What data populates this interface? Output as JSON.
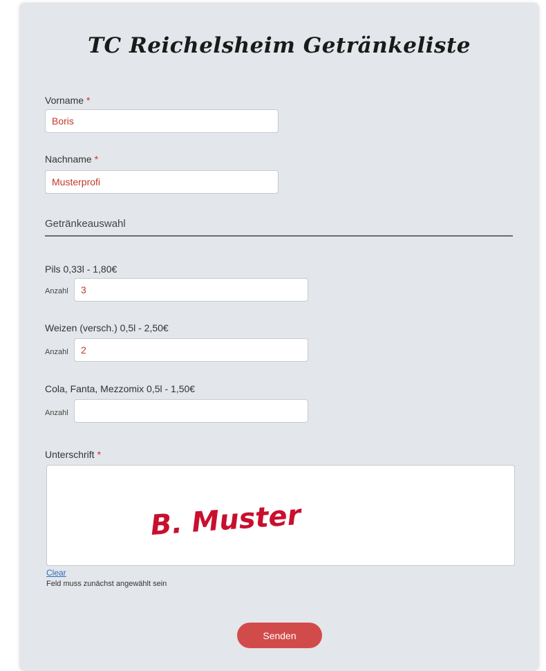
{
  "form": {
    "title": "TC Reichelsheim Getränkeliste",
    "required_marker": "*",
    "first_name": {
      "label": "Vorname",
      "value": "Boris"
    },
    "last_name": {
      "label": "Nachname",
      "value": "Musterprofi"
    },
    "drinks_section_title": "Getränkeauswahl",
    "quantity_label": "Anzahl",
    "drinks": [
      {
        "name": "Pils 0,33l - 1,80€",
        "quantity": "3"
      },
      {
        "name": "Weizen (versch.) 0,5l - 2,50€",
        "quantity": "2"
      },
      {
        "name": "Cola, Fanta, Mezzomix 0,5l - 1,50€",
        "quantity": ""
      }
    ],
    "signature": {
      "label": "Unterschrift",
      "value": "B. Muster",
      "clear_label": "Clear",
      "hint": "Feld muss zunächst angewählt sein"
    },
    "submit_label": "Senden"
  },
  "colors": {
    "card_background": "#e3e6ea",
    "accent": "#d24b4b",
    "required": "#d0302f",
    "input_text": "#c0392b",
    "signature_ink": "#c8102e",
    "link": "#2a6ebb"
  }
}
